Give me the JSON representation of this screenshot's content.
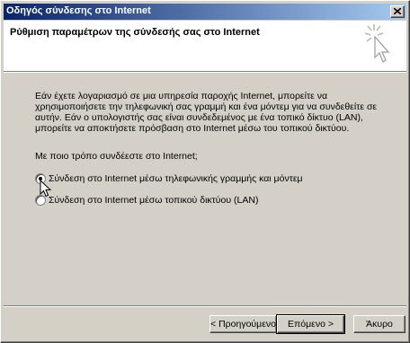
{
  "window": {
    "title": "Οδηγός σύνδεσης στο Internet"
  },
  "header": {
    "title": "Ρύθμιση παραμέτρων της σύνδεσής σας στο Internet",
    "icon": "wizard-sparkle-cursor-icon"
  },
  "body": {
    "description": "Εάν έχετε λογαριασμό σε μια υπηρεσία παροχής Internet, μπορείτε να χρησιμοποιήσετε την τηλεφωνική σας γραμμή και ένα μόντεμ για να συνδεθείτε σε αυτήν. Εάν ο υπολογιστής σας είναι συνδεδεμένος με ένα τοπικό δίκτυο (LAN), μπορείτε να αποκτήσετε πρόσβαση στο Internet μέσω του τοπικού δικτύου.",
    "question": "Με ποιο τρόπο συνδέεστε στο Internet;",
    "options": [
      {
        "label": "Σύνδεση στο Internet μέσω τηλεφωνικής γραμμής και μόντεμ",
        "selected": true
      },
      {
        "label": "Σύνδεση στο Internet μέσω τοπικού δικτύου (LAN)",
        "selected": false
      }
    ]
  },
  "footer": {
    "back_label": "< Προηγούμενο",
    "next_label": "Επόμενο >",
    "cancel_label": "Άκυρο"
  },
  "colors": {
    "titlebar_start": "#0a246a",
    "titlebar_end": "#a6caf0",
    "face": "#d4d0c8"
  }
}
